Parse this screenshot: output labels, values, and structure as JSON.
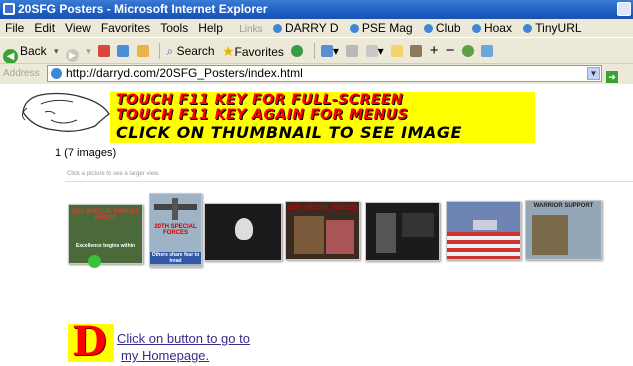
{
  "window": {
    "title": "20SFG Posters - Microsoft Internet Explorer"
  },
  "menu": [
    "File",
    "Edit",
    "View",
    "Favorites",
    "Tools",
    "Help"
  ],
  "links_label": "Links",
  "links": [
    "DARRY D",
    "PSE Mag",
    "Club",
    "Hoax",
    "TinyURL"
  ],
  "toolbar": {
    "back": "Back",
    "search": "Search",
    "favorites": "Favorites"
  },
  "address": {
    "label": "Address",
    "url": "http://darryd.com/20SFG_Posters/index.html",
    "go": "Go"
  },
  "page": {
    "banner_line1": "TOUCH F11 KEY FOR FULL-SCREEN",
    "banner_line2": "TOUCH F11 KEY AGAIN FOR MENUS",
    "banner_line3": "CLICK ON THUMBNAIL TO SEE IMAGE",
    "image_count": "1 (7 images)",
    "hint": "Click a picture to see a larger view.",
    "logo_letter": "D",
    "home_link_line1": "Click on button to go to",
    "home_link_line2": "my Homepage."
  },
  "thumbnails": [
    {
      "caption": "20th SPECIAL FORCES GROUP",
      "sub": "Excellence begins within"
    },
    {
      "caption": "20TH SPECIAL FORCES",
      "sub": "Others share fear to tread"
    },
    {
      "caption": "",
      "sub": ""
    },
    {
      "caption": "20TH SPECIAL FORCES",
      "sub": ""
    },
    {
      "caption": "",
      "sub": ""
    },
    {
      "caption": "",
      "sub": ""
    },
    {
      "caption": "WARRIOR SUPPORT",
      "sub": ""
    }
  ],
  "colors": {
    "titlebar": "#1e5fc2",
    "banner_bg": "#ffff00",
    "banner_text": "#ff0000",
    "link": "#3b2a8a"
  }
}
